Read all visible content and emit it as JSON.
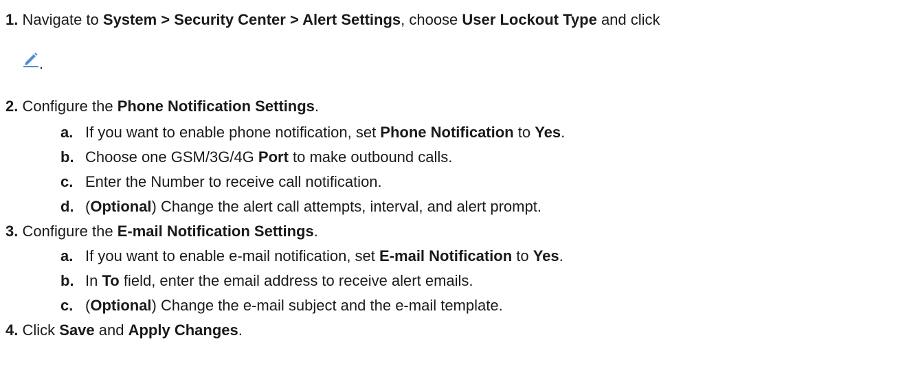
{
  "steps": [
    {
      "number": "1.",
      "parts": [
        {
          "t": "Navigate to ",
          "b": false
        },
        {
          "t": "System > Security Center > Alert Settings",
          "b": true
        },
        {
          "t": ", choose ",
          "b": false
        },
        {
          "t": "User Lockout Type",
          "b": true
        },
        {
          "t": " and click",
          "b": false
        }
      ],
      "after_icon": ".",
      "icon": "pencil-edit-icon",
      "icon_color": "#4a90d9"
    },
    {
      "number": "2.",
      "parts": [
        {
          "t": "Configure the ",
          "b": false
        },
        {
          "t": "Phone Notification Settings",
          "b": true
        },
        {
          "t": ".",
          "b": false
        }
      ],
      "substeps": [
        {
          "label": "a.",
          "parts": [
            {
              "t": "If you want to enable phone notification, set ",
              "b": false
            },
            {
              "t": "Phone Notification",
              "b": true
            },
            {
              "t": " to ",
              "b": false
            },
            {
              "t": "Yes",
              "b": true
            },
            {
              "t": ".",
              "b": false
            }
          ]
        },
        {
          "label": "b.",
          "parts": [
            {
              "t": "Choose one GSM/3G/4G ",
              "b": false
            },
            {
              "t": "Port",
              "b": true
            },
            {
              "t": " to make outbound calls.",
              "b": false
            }
          ]
        },
        {
          "label": "c.",
          "parts": [
            {
              "t": "Enter the Number to receive call notification.",
              "b": false
            }
          ]
        },
        {
          "label": "d.",
          "parts": [
            {
              "t": "(",
              "b": false
            },
            {
              "t": "Optional",
              "b": true
            },
            {
              "t": ") Change the alert call attempts, interval, and alert prompt.",
              "b": false
            }
          ]
        }
      ]
    },
    {
      "number": "3.",
      "parts": [
        {
          "t": "Configure the ",
          "b": false
        },
        {
          "t": "E-mail Notification Settings",
          "b": true
        },
        {
          "t": ".",
          "b": false
        }
      ],
      "substeps": [
        {
          "label": "a.",
          "parts": [
            {
              "t": "If you want to enable e-mail notification, set ",
              "b": false
            },
            {
              "t": "E-mail Notification",
              "b": true
            },
            {
              "t": " to ",
              "b": false
            },
            {
              "t": "Yes",
              "b": true
            },
            {
              "t": ".",
              "b": false
            }
          ]
        },
        {
          "label": "b.",
          "parts": [
            {
              "t": "In ",
              "b": false
            },
            {
              "t": "To",
              "b": true
            },
            {
              "t": " field, enter the email address to receive alert emails.",
              "b": false
            }
          ]
        },
        {
          "label": "c.",
          "parts": [
            {
              "t": "(",
              "b": false
            },
            {
              "t": "Optional",
              "b": true
            },
            {
              "t": ") Change the e-mail subject and the e-mail template.",
              "b": false
            }
          ]
        }
      ]
    },
    {
      "number": "4.",
      "parts": [
        {
          "t": "Click ",
          "b": false
        },
        {
          "t": "Save",
          "b": true
        },
        {
          "t": " and ",
          "b": false
        },
        {
          "t": "Apply Changes",
          "b": true
        },
        {
          "t": ".",
          "b": false
        }
      ]
    }
  ]
}
